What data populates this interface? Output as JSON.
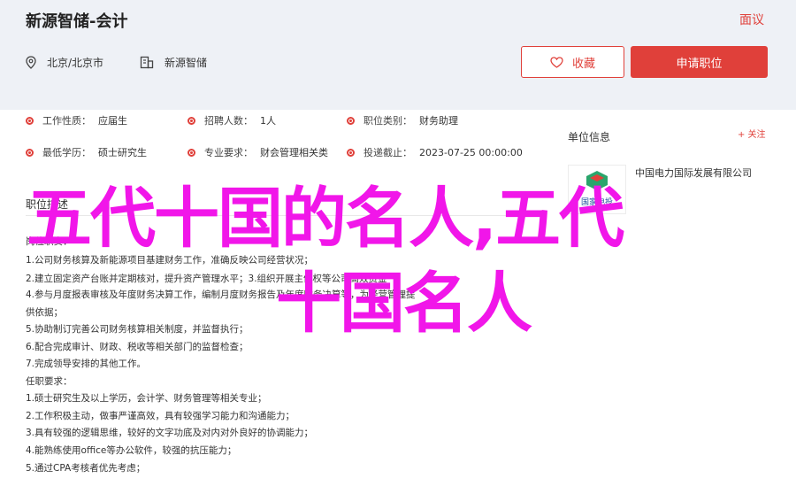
{
  "header": {
    "job_title": "新源智储-会计",
    "report_label": "面议",
    "location": "北京/北京市",
    "company": "新源智储",
    "favorite_label": "收藏",
    "apply_label": "申请职位"
  },
  "info": [
    {
      "label": "工作性质：",
      "value": "应届生"
    },
    {
      "label": "招聘人数：",
      "value": "1人"
    },
    {
      "label": "职位类别：",
      "value": "财务助理"
    },
    {
      "label": "最低学历：",
      "value": "硕士研究生"
    },
    {
      "label": "专业要求：",
      "value": "财会管理相关类"
    },
    {
      "label": "投递截止：",
      "value": "2023-07-25 00:00:00"
    }
  ],
  "description": {
    "title": "职位描述",
    "lines": [
      "岗位职责：",
      "1.公司财务核算及新能源项目基建财务工作，准确反映公司经营状况；",
      "2.建立固定资产台账并定期核对，提升资产管理水平；3.组织开展主债权等公司高效资金",
      "4.参与月度报表审核及年度财务决算工作，编制月度财务报告及年度财务决算等，为经营管理提",
      "供依据；",
      "5.协助制订完善公司财务核算相关制度，并监督执行；",
      "6.配合完成审计、财政、税收等相关部门的监督检查；",
      "7.完成领导安排的其他工作。",
      "任职要求：",
      "1.硕士研究生及以上学历，会计学、财务管理等相关专业；",
      "2.工作积极主动，做事严谨高效，具有较强学习能力和沟通能力；",
      "3.具有较强的逻辑思维，较好的文字功底及对内对外良好的协调能力；",
      "4.能熟练使用office等办公软件，较强的抗压能力；",
      "5.通过CPA考核者优先考虑；"
    ]
  },
  "company_panel": {
    "title": "单位信息",
    "follow_label": "+ 关注",
    "name": "中国电力国际发展有限公司",
    "logo_text": "国家电投"
  },
  "overlay": {
    "line1": "五代十国的名人,五代",
    "line2": "十国名人"
  },
  "colors": {
    "accent": "#e0403a",
    "overlay": "#f116e9",
    "header_bg": "#eef1f6"
  }
}
